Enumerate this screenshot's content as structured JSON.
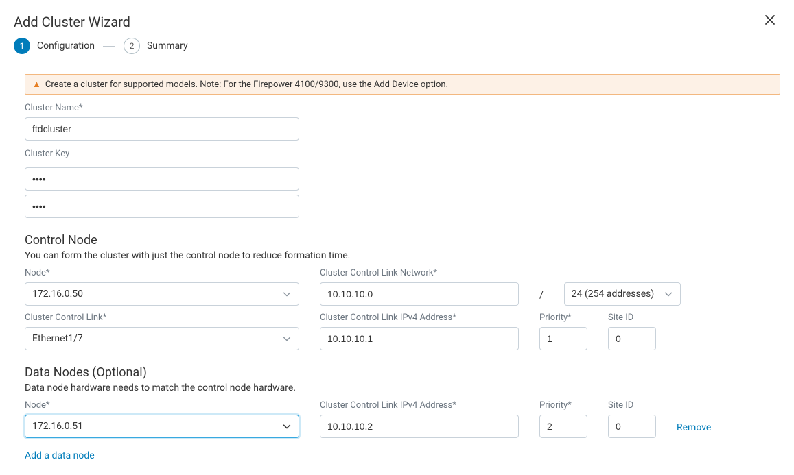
{
  "dialog": {
    "title": "Add Cluster Wizard",
    "close_label": "Close"
  },
  "stepper": {
    "steps": [
      {
        "num": "1",
        "label": "Configuration",
        "active": true
      },
      {
        "num": "2",
        "label": "Summary",
        "active": false
      }
    ]
  },
  "banner": {
    "text": "Create a cluster for supported models. Note: For the Firepower 4100/9300, use the Add Device option."
  },
  "form": {
    "cluster_name": {
      "label": "Cluster Name*",
      "value": "ftdcluster"
    },
    "cluster_key": {
      "label": "Cluster Key",
      "value1": "••••",
      "value2": "••••"
    },
    "control_node": {
      "title": "Control Node",
      "desc": "You can form the cluster with just the control node to reduce formation time.",
      "node": {
        "label": "Node*",
        "value": "172.16.0.50"
      },
      "ccl_network": {
        "label": "Cluster Control Link Network*",
        "value": "10.10.10.0"
      },
      "cidr": {
        "value": "24 (254 addresses)",
        "slash": "/"
      },
      "ccl": {
        "label": "Cluster Control Link*",
        "value": "Ethernet1/7"
      },
      "ccl_ipv4": {
        "label": "Cluster Control Link IPv4 Address*",
        "value": "10.10.10.1"
      },
      "priority": {
        "label": "Priority*",
        "value": "1"
      },
      "site_id": {
        "label": "Site ID",
        "value": "0"
      }
    },
    "data_nodes": {
      "title": "Data Nodes (Optional)",
      "desc": "Data node hardware needs to match the control node hardware.",
      "rows": [
        {
          "node": {
            "label": "Node*",
            "value": "172.16.0.51"
          },
          "ccl_ipv4": {
            "label": "Cluster Control Link IPv4 Address*",
            "value": "10.10.10.2"
          },
          "priority": {
            "label": "Priority*",
            "value": "2"
          },
          "site_id": {
            "label": "Site ID",
            "value": "0"
          },
          "remove_label": "Remove"
        }
      ],
      "add_link": "Add a data node"
    }
  }
}
